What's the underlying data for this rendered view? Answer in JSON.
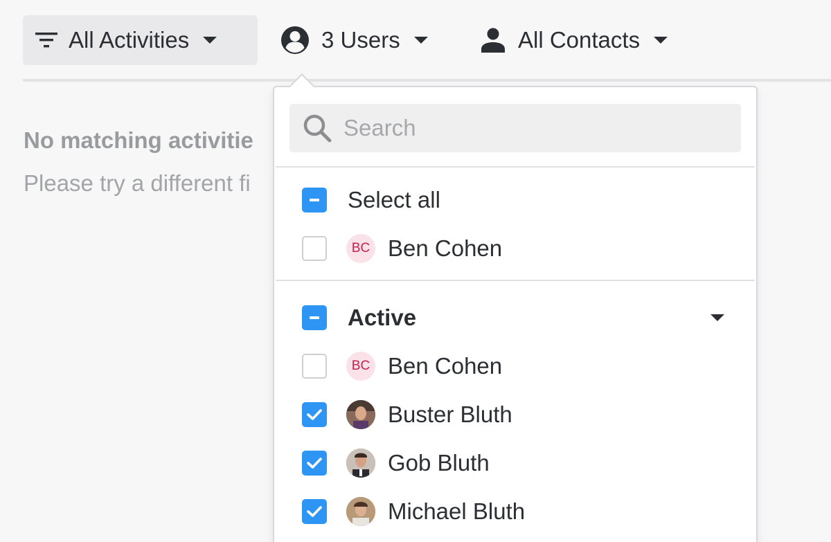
{
  "toolbar": {
    "activities": {
      "label": "All Activities",
      "icon": "filter-icon"
    },
    "users": {
      "label": "3 Users",
      "icon": "user-circle-icon"
    },
    "contacts": {
      "label": "All Contacts",
      "icon": "person-icon"
    }
  },
  "empty_state": {
    "title": "No matching activitie",
    "subtitle": "Please try a different fi"
  },
  "dropdown": {
    "search": {
      "placeholder": "Search",
      "value": ""
    },
    "select_all": {
      "label": "Select all",
      "state": "partial"
    },
    "pinned_user": {
      "initials": "BC",
      "name": "Ben Cohen",
      "checked": false
    },
    "group": {
      "label": "Active",
      "state": "partial",
      "members": [
        {
          "initials": "BC",
          "name": "Ben Cohen",
          "checked": false,
          "avatar": "initials"
        },
        {
          "name": "Buster Bluth",
          "checked": true,
          "avatar": "photo"
        },
        {
          "name": "Gob Bluth",
          "checked": true,
          "avatar": "photo"
        },
        {
          "name": "Michael Bluth",
          "checked": true,
          "avatar": "photo"
        }
      ]
    }
  },
  "colors": {
    "accent": "#2f95f5",
    "initials_bg": "#fbe1e8",
    "initials_fg": "#c4234f"
  }
}
